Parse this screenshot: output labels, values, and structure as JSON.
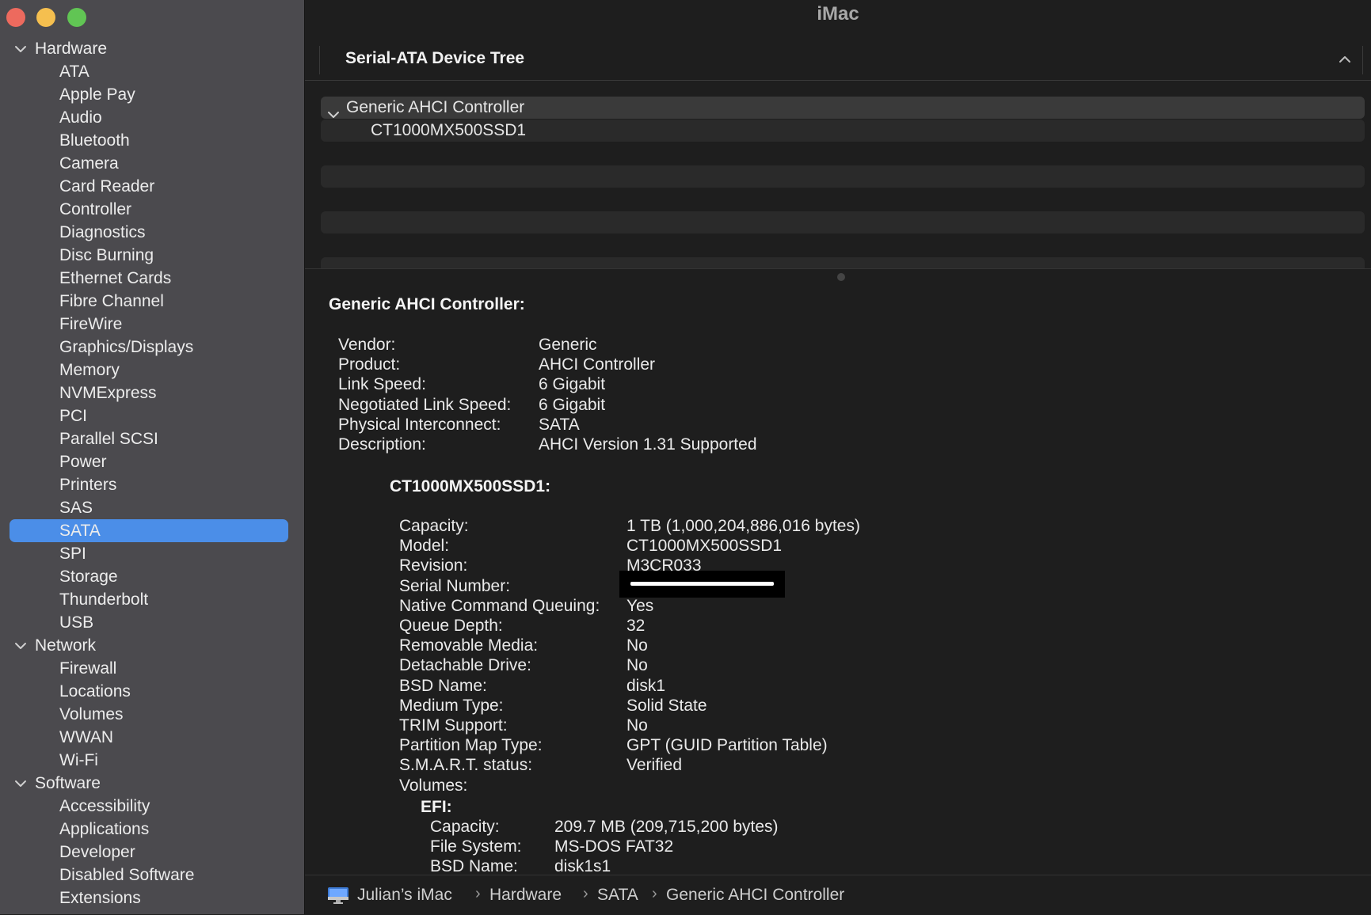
{
  "window": {
    "title": "iMac"
  },
  "sidebar": {
    "sections": [
      {
        "label": "Hardware",
        "items": [
          "ATA",
          "Apple Pay",
          "Audio",
          "Bluetooth",
          "Camera",
          "Card Reader",
          "Controller",
          "Diagnostics",
          "Disc Burning",
          "Ethernet Cards",
          "Fibre Channel",
          "FireWire",
          "Graphics/Displays",
          "Memory",
          "NVMExpress",
          "PCI",
          "Parallel SCSI",
          "Power",
          "Printers",
          "SAS",
          "SATA",
          "SPI",
          "Storage",
          "Thunderbolt",
          "USB"
        ]
      },
      {
        "label": "Network",
        "items": [
          "Firewall",
          "Locations",
          "Volumes",
          "WWAN",
          "Wi-Fi"
        ]
      },
      {
        "label": "Software",
        "items": [
          "Accessibility",
          "Applications",
          "Developer",
          "Disabled Software",
          "Extensions"
        ]
      }
    ],
    "selected": "SATA"
  },
  "tree": {
    "header": "Serial-ATA Device Tree",
    "controller": "Generic AHCI Controller",
    "device": "CT1000MX500SSD1"
  },
  "detail": {
    "controller_title": "Generic AHCI Controller:",
    "controller_props": [
      {
        "label": "Vendor:",
        "value": "Generic"
      },
      {
        "label": "Product:",
        "value": "AHCI Controller"
      },
      {
        "label": "Link Speed:",
        "value": "6 Gigabit"
      },
      {
        "label": "Negotiated Link Speed:",
        "value": "6 Gigabit"
      },
      {
        "label": "Physical Interconnect:",
        "value": "SATA"
      },
      {
        "label": "Description:",
        "value": "AHCI Version 1.31 Supported"
      }
    ],
    "device_title": "CT1000MX500SSD1:",
    "device_props": [
      {
        "label": "Capacity:",
        "value": "1 TB (1,000,204,886,016 bytes)"
      },
      {
        "label": "Model:",
        "value": "CT1000MX500SSD1"
      },
      {
        "label": "Revision:",
        "value": "M3CR033"
      },
      {
        "label": "Serial Number:",
        "value": ""
      },
      {
        "label": "Native Command Queuing:",
        "value": "Yes"
      },
      {
        "label": "Queue Depth:",
        "value": "32"
      },
      {
        "label": "Removable Media:",
        "value": "No"
      },
      {
        "label": "Detachable Drive:",
        "value": "No"
      },
      {
        "label": "BSD Name:",
        "value": "disk1"
      },
      {
        "label": "Medium Type:",
        "value": "Solid State"
      },
      {
        "label": "TRIM Support:",
        "value": "No"
      },
      {
        "label": "Partition Map Type:",
        "value": "GPT (GUID Partition Table)"
      },
      {
        "label": "S.M.A.R.T. status:",
        "value": "Verified"
      },
      {
        "label": "Volumes:",
        "value": ""
      }
    ],
    "volume_title": "EFI:",
    "volume_props": [
      {
        "label": "Capacity:",
        "value": "209.7 MB (209,715,200 bytes)"
      },
      {
        "label": "File System:",
        "value": "MS-DOS FAT32"
      },
      {
        "label": "BSD Name:",
        "value": "disk1s1"
      }
    ]
  },
  "pathbar": {
    "crumbs": [
      "Julian’s iMac",
      "Hardware",
      "SATA",
      "Generic AHCI Controller"
    ]
  },
  "colors": {
    "accent": "#4b8ee8",
    "sidebar_bg": "#4b4a4e",
    "main_bg": "#1e1e1e"
  }
}
